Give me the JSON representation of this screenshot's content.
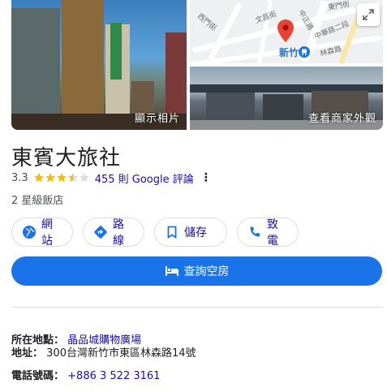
{
  "photos": {
    "main_label": "顯示相片",
    "store_label": "查看商家外觀"
  },
  "map": {
    "station": "新竹",
    "street_labels": [
      "中正路",
      "文昌街",
      "中華路二段",
      "西門街",
      "東門街",
      "林森路"
    ]
  },
  "business": {
    "name": "東賓大旅社",
    "rating": "3.3",
    "rating_value": 3.3,
    "reviews": "455 則 Google 評論",
    "category": "2 星級飯店"
  },
  "actions": {
    "website": "網站",
    "directions": "路線",
    "save": "儲存",
    "call": "致電"
  },
  "book": {
    "label": "查詢空房"
  },
  "details": {
    "location_key": "所在地點：",
    "location_value": "晶品城購物廣場",
    "address_key": "地址：",
    "address_value": "300台灣新竹市東區林森路14號",
    "phone_key": "電話號碼：",
    "phone_value": "+886 3 522 3161"
  },
  "colors": {
    "accent": "#1a73e8",
    "link": "#1a0dab",
    "star": "#fbbc04",
    "pin": "#ea4335"
  }
}
